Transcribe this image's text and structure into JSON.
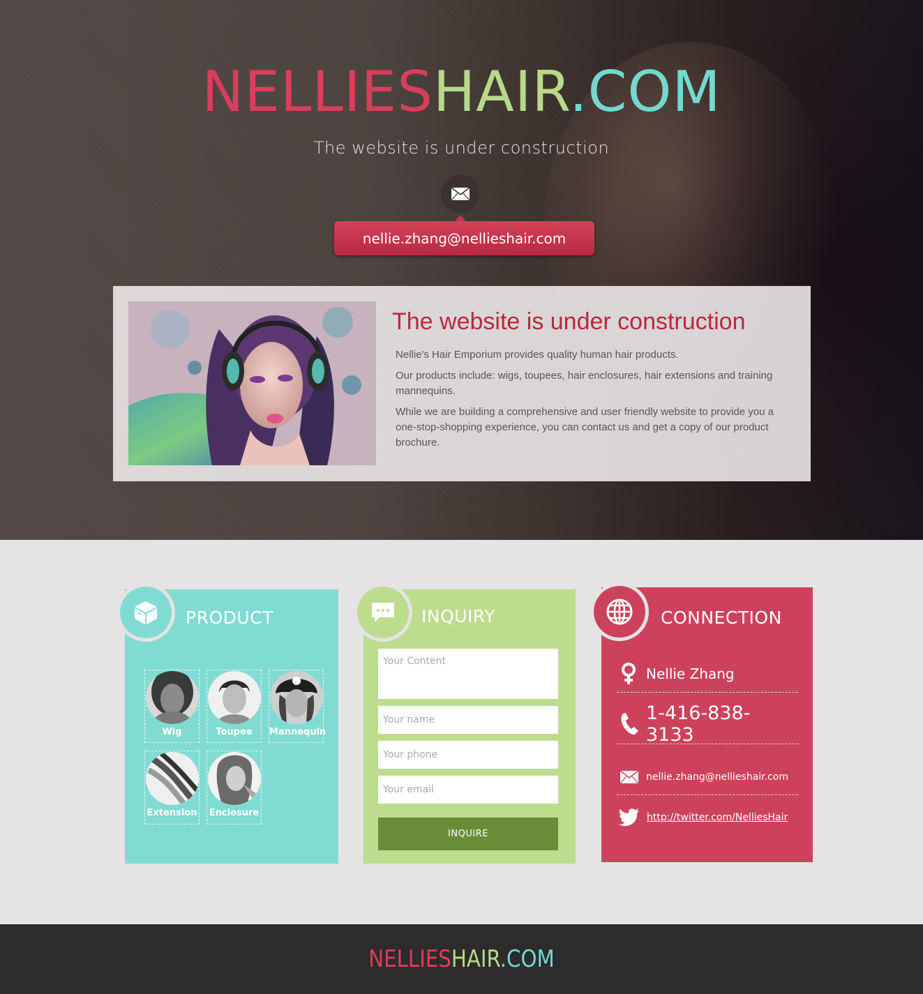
{
  "colors": {
    "pink": "#d73f5c",
    "green": "#b8d98a",
    "teal": "#74d8cf",
    "product_bg": "#80dcd2",
    "inquiry_bg": "#bddc8e",
    "connection_bg": "#cc425c",
    "button_green": "#6a8c38"
  },
  "logo": {
    "part1": "NELLIES",
    "part2": "HAIR",
    "part3": ".COM"
  },
  "hero": {
    "tagline": "The website is under construction",
    "email": "nellie.zhang@nellieshair.com"
  },
  "intro": {
    "title": "The website is under construction",
    "paragraphs": [
      "Nellie's Hair Emporium provides quality human hair products.",
      "Our products include: wigs, toupees, hair enclosures, hair extensions and training mannequins.",
      "While we are building a comprehensive and user friendly website to provide you a one-stop-shopping experience, you can contact us and get a copy of our product brochure."
    ]
  },
  "product": {
    "title": "PRODUCT",
    "items": [
      {
        "label": "Wig"
      },
      {
        "label": "Toupee"
      },
      {
        "label": "Mannequin"
      },
      {
        "label": "Extension"
      },
      {
        "label": "Enclosure"
      }
    ]
  },
  "inquiry": {
    "title": "INQUIRY",
    "content_placeholder": "Your Content",
    "name_placeholder": "Your name",
    "phone_placeholder": "Your phone",
    "email_placeholder": "Your email",
    "button_label": "INQUIRE"
  },
  "connection": {
    "title": "CONNECTION",
    "name": "Nellie Zhang",
    "phone": "1-416-838-3133",
    "email": "nellie.zhang@nellieshair.com",
    "twitter": "http://twitter.com/NelliesHair"
  },
  "footer": {
    "part1": "NELLIES",
    "part2": "HAIR",
    "part3": ".COM"
  }
}
